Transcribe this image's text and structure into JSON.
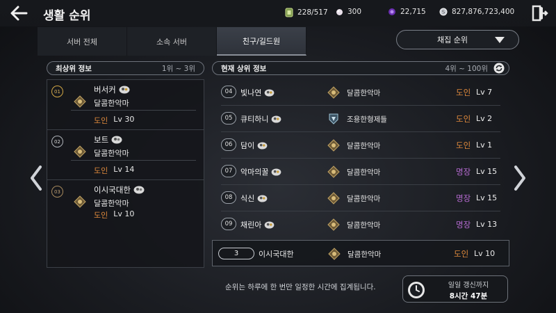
{
  "header": {
    "title": "생활 순위",
    "stamina": "228/517",
    "pearls": "300",
    "gems": "22,715",
    "silver": "827,876,723,400"
  },
  "tabs": [
    {
      "label": "서버 전체",
      "active": false
    },
    {
      "label": "소속 서버",
      "active": false
    },
    {
      "label": "친구/길드원",
      "active": true
    }
  ],
  "sort_dropdown": {
    "selected": "채집 순위"
  },
  "top_section": {
    "title": "최상위 정보",
    "range": "1위 ~ 3위"
  },
  "current_section": {
    "title": "현재 상위 정보",
    "range": "4위 ~ 100위"
  },
  "top_ranks": [
    {
      "rank": "01",
      "name": "버서커",
      "guild": "달콤한악마",
      "class": "도인",
      "level": "Lv 30"
    },
    {
      "rank": "02",
      "name": "보트",
      "guild": "달콤한악마",
      "class": "도인",
      "level": "Lv 14"
    },
    {
      "rank": "03",
      "name": "이시국대한",
      "guild": "달콤한악마",
      "class": "도인",
      "level": "Lv 10"
    }
  ],
  "ranks": [
    {
      "rank": "04",
      "name": "빛나연",
      "guild": "달콤한악마",
      "class": "도인",
      "level": "Lv 7",
      "emblem": "gold"
    },
    {
      "rank": "05",
      "name": "큐티하니",
      "guild": "조용한형제들",
      "class": "도인",
      "level": "Lv 2",
      "emblem": "blue"
    },
    {
      "rank": "06",
      "name": "담이",
      "guild": "달콤한악마",
      "class": "도인",
      "level": "Lv 1",
      "emblem": "gold"
    },
    {
      "rank": "07",
      "name": "악마의꿀",
      "guild": "달콤한악마",
      "class": "명장",
      "level": "Lv 15",
      "emblem": "gold"
    },
    {
      "rank": "08",
      "name": "식신",
      "guild": "달콤한악마",
      "class": "명장",
      "level": "Lv 15",
      "emblem": "gold"
    },
    {
      "rank": "09",
      "name": "채린아",
      "guild": "달콤한악마",
      "class": "명장",
      "level": "Lv 13",
      "emblem": "gold"
    }
  ],
  "my_rank": {
    "rank": "3",
    "name": "이시국대한",
    "guild": "달콤한악마",
    "class": "도인",
    "level": "Lv 10"
  },
  "footer": {
    "notice": "순위는 하루에 한 번만 일정한 시간에 집계됩니다.",
    "timer_label": "일일 갱신까지",
    "timer_value": "8시간 47분"
  },
  "colors": {
    "doin": "#e08a3c",
    "myeong": "#b56ad0",
    "gold_rank": "#d4a946"
  }
}
